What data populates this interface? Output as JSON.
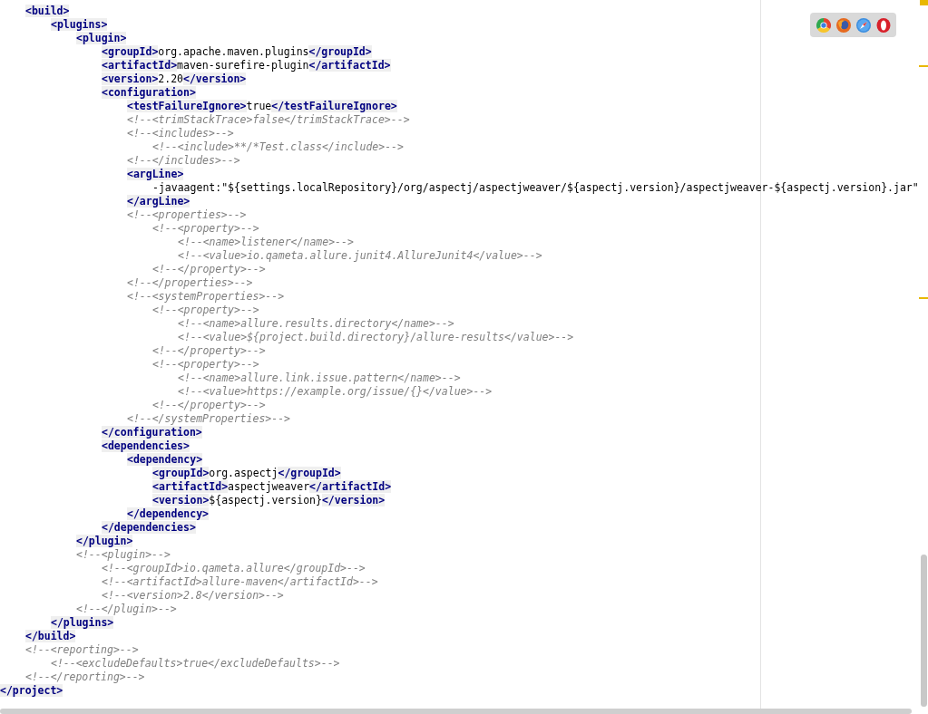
{
  "editor": {
    "block": [
      {
        "tokens": [
          {
            "kind": "tag",
            "text": "<build>"
          }
        ],
        "children": [
          {
            "tokens": [
              {
                "kind": "tag",
                "text": "<plugins>"
              }
            ],
            "children": [
              {
                "tokens": [
                  {
                    "kind": "tag",
                    "text": "<plugin>"
                  }
                ],
                "children": [
                  {
                    "tokens": [
                      {
                        "kind": "tag",
                        "text": "<groupId>"
                      },
                      {
                        "kind": "text",
                        "text": "org.apache.maven.plugins"
                      },
                      {
                        "kind": "tag",
                        "text": "</groupId>"
                      }
                    ]
                  },
                  {
                    "tokens": [
                      {
                        "kind": "tag",
                        "text": "<artifactId>"
                      },
                      {
                        "kind": "text",
                        "text": "maven-surefire-plugin"
                      },
                      {
                        "kind": "tag",
                        "text": "</artifactId>"
                      }
                    ]
                  },
                  {
                    "tokens": [
                      {
                        "kind": "tag",
                        "text": "<version>"
                      },
                      {
                        "kind": "text",
                        "text": "2.20"
                      },
                      {
                        "kind": "tag",
                        "text": "</version>"
                      }
                    ]
                  },
                  {
                    "tokens": [
                      {
                        "kind": "tag",
                        "text": "<configuration>"
                      }
                    ],
                    "children": [
                      {
                        "tokens": [
                          {
                            "kind": "tag",
                            "text": "<testFailureIgnore>"
                          },
                          {
                            "kind": "text",
                            "text": "true"
                          },
                          {
                            "kind": "tag",
                            "text": "</testFailureIgnore>"
                          }
                        ]
                      },
                      {
                        "tokens": [
                          {
                            "kind": "comment",
                            "text": "<!--<trimStackTrace>false</trimStackTrace>-->"
                          }
                        ]
                      },
                      {
                        "tokens": [
                          {
                            "kind": "comment",
                            "text": "<!--<includes>-->"
                          }
                        ],
                        "children": [
                          {
                            "tokens": [
                              {
                                "kind": "comment",
                                "text": "<!--<include>**/*Test.class</include>-->"
                              }
                            ]
                          }
                        ]
                      },
                      {
                        "tokens": [
                          {
                            "kind": "comment",
                            "text": "<!--</includes>-->"
                          }
                        ]
                      },
                      {
                        "tokens": [
                          {
                            "kind": "tag",
                            "text": "<argLine>"
                          }
                        ],
                        "children": [
                          {
                            "tokens": [
                              {
                                "kind": "text",
                                "text": "-javaagent:\"${settings.localRepository}/org/aspectj/aspectjweaver/${aspectj.version}/aspectjweaver-${aspectj.version}.jar\""
                              }
                            ]
                          }
                        ]
                      },
                      {
                        "tokens": [
                          {
                            "kind": "tag",
                            "text": "</argLine>"
                          }
                        ]
                      },
                      {
                        "tokens": [
                          {
                            "kind": "comment",
                            "text": "<!--<properties>-->"
                          }
                        ],
                        "children": [
                          {
                            "tokens": [
                              {
                                "kind": "comment",
                                "text": "<!--<property>-->"
                              }
                            ],
                            "children": [
                              {
                                "tokens": [
                                  {
                                    "kind": "comment",
                                    "text": "<!--<name>listener</name>-->"
                                  }
                                ]
                              },
                              {
                                "tokens": [
                                  {
                                    "kind": "comment",
                                    "text": "<!--<value>io.qameta.allure.junit4.AllureJunit4</value>-->"
                                  }
                                ]
                              }
                            ]
                          },
                          {
                            "tokens": [
                              {
                                "kind": "comment",
                                "text": "<!--</property>-->"
                              }
                            ]
                          }
                        ]
                      },
                      {
                        "tokens": [
                          {
                            "kind": "comment",
                            "text": "<!--</properties>-->"
                          }
                        ]
                      },
                      {
                        "tokens": [
                          {
                            "kind": "comment",
                            "text": "<!--<systemProperties>-->"
                          }
                        ],
                        "children": [
                          {
                            "tokens": [
                              {
                                "kind": "comment",
                                "text": "<!--<property>-->"
                              }
                            ],
                            "children": [
                              {
                                "tokens": [
                                  {
                                    "kind": "comment",
                                    "text": "<!--<name>allure.results.directory</name>-->"
                                  }
                                ]
                              },
                              {
                                "tokens": [
                                  {
                                    "kind": "comment",
                                    "text": "<!--<value>${project.build.directory}/allure-results</value>-->"
                                  }
                                ]
                              }
                            ]
                          },
                          {
                            "tokens": [
                              {
                                "kind": "comment",
                                "text": "<!--</property>-->"
                              }
                            ]
                          },
                          {
                            "tokens": [
                              {
                                "kind": "comment",
                                "text": "<!--<property>-->"
                              }
                            ],
                            "children": [
                              {
                                "tokens": [
                                  {
                                    "kind": "comment",
                                    "text": "<!--<name>allure.link.issue.pattern</name>-->"
                                  }
                                ]
                              },
                              {
                                "tokens": [
                                  {
                                    "kind": "comment",
                                    "text": "<!--<value>https://example.org/issue/{}</value>-->"
                                  }
                                ]
                              }
                            ]
                          },
                          {
                            "tokens": [
                              {
                                "kind": "comment",
                                "text": "<!--</property>-->"
                              }
                            ]
                          }
                        ]
                      },
                      {
                        "tokens": [
                          {
                            "kind": "comment",
                            "text": "<!--</systemProperties>-->"
                          }
                        ]
                      }
                    ]
                  },
                  {
                    "tokens": [
                      {
                        "kind": "tag",
                        "text": "</configuration>"
                      }
                    ]
                  },
                  {
                    "tokens": [
                      {
                        "kind": "tag",
                        "text": "<dependencies>"
                      }
                    ],
                    "children": [
                      {
                        "tokens": [
                          {
                            "kind": "tag",
                            "text": "<dependency>"
                          }
                        ],
                        "children": [
                          {
                            "tokens": [
                              {
                                "kind": "tag",
                                "text": "<groupId>"
                              },
                              {
                                "kind": "text",
                                "text": "org.aspectj"
                              },
                              {
                                "kind": "tag",
                                "text": "</groupId>"
                              }
                            ]
                          },
                          {
                            "tokens": [
                              {
                                "kind": "tag",
                                "text": "<artifactId>"
                              },
                              {
                                "kind": "text",
                                "text": "aspectjweaver"
                              },
                              {
                                "kind": "tag",
                                "text": "</artifactId>"
                              }
                            ]
                          },
                          {
                            "tokens": [
                              {
                                "kind": "tag",
                                "text": "<version>"
                              },
                              {
                                "kind": "text",
                                "text": "${aspectj.version}"
                              },
                              {
                                "kind": "tag",
                                "text": "</version>"
                              }
                            ]
                          }
                        ]
                      },
                      {
                        "tokens": [
                          {
                            "kind": "tag",
                            "text": "</dependency>"
                          }
                        ]
                      }
                    ]
                  },
                  {
                    "tokens": [
                      {
                        "kind": "tag",
                        "text": "</dependencies>"
                      }
                    ]
                  }
                ]
              },
              {
                "tokens": [
                  {
                    "kind": "tag",
                    "text": "</plugin>"
                  }
                ]
              },
              {
                "tokens": [
                  {
                    "kind": "comment",
                    "text": "<!--<plugin>-->"
                  }
                ],
                "children": [
                  {
                    "tokens": [
                      {
                        "kind": "comment",
                        "text": "<!--<groupId>io.qameta.allure</groupId>-->"
                      }
                    ]
                  },
                  {
                    "tokens": [
                      {
                        "kind": "comment",
                        "text": "<!--<artifactId>allure-maven</artifactId>-->"
                      }
                    ]
                  },
                  {
                    "tokens": [
                      {
                        "kind": "comment",
                        "text": "<!--<version>2.8</version>-->"
                      }
                    ]
                  }
                ]
              },
              {
                "tokens": [
                  {
                    "kind": "comment",
                    "text": "<!--</plugin>-->"
                  }
                ]
              }
            ]
          },
          {
            "tokens": [
              {
                "kind": "tag",
                "text": "</plugins>"
              }
            ]
          }
        ]
      },
      {
        "tokens": [
          {
            "kind": "tag",
            "text": "</build>"
          }
        ]
      },
      {
        "tokens": [
          {
            "kind": "comment",
            "text": "<!--<reporting>-->"
          }
        ],
        "children": [
          {
            "tokens": [
              {
                "kind": "comment",
                "text": "<!--<excludeDefaults>true</excludeDefaults>-->"
              }
            ]
          }
        ]
      },
      {
        "tokens": [
          {
            "kind": "comment",
            "text": "<!--</reporting>-->"
          }
        ]
      }
    ],
    "closing": {
      "tokens": [
        {
          "kind": "tag",
          "text": "</project>"
        }
      ]
    }
  }
}
